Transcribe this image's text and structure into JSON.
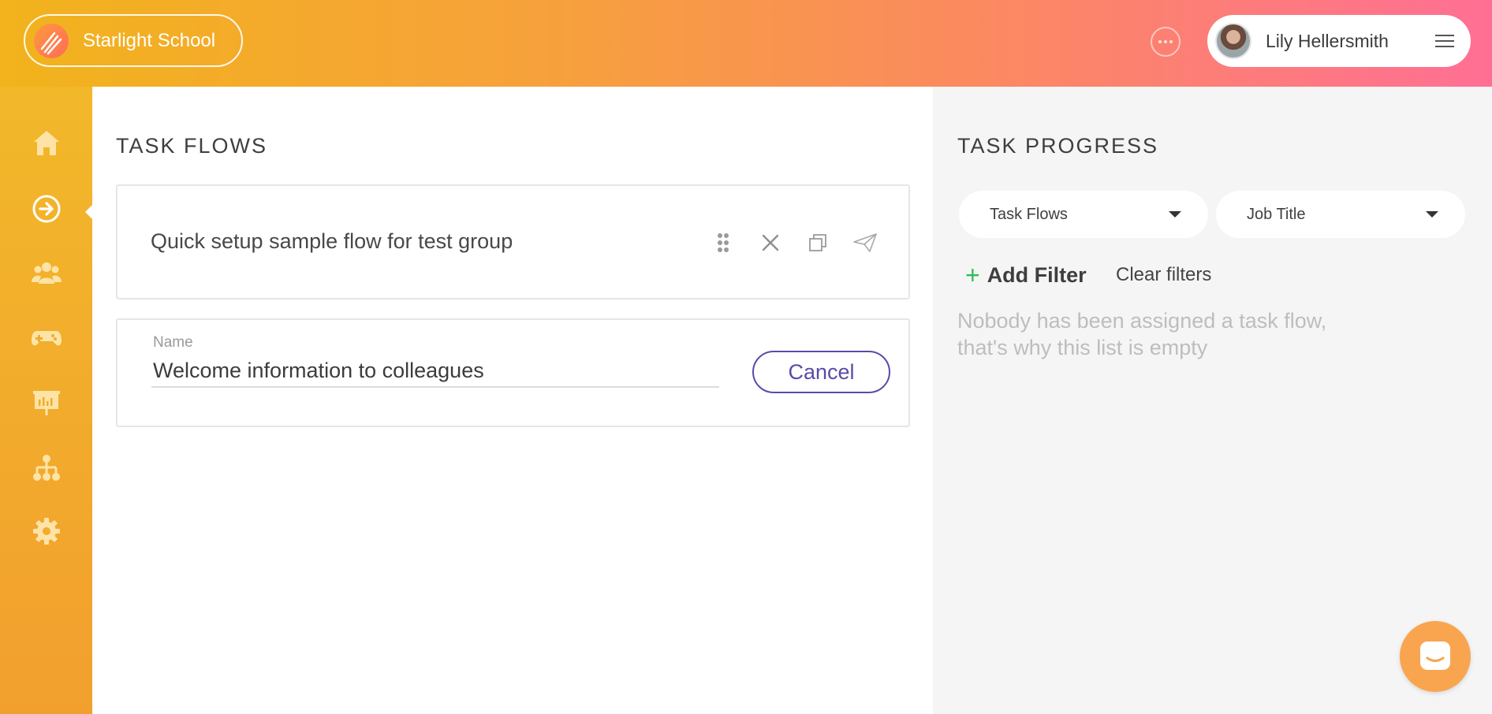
{
  "header": {
    "school_name": "Starlight School",
    "user_name": "Lily Hellersmith"
  },
  "sidebar": {
    "items": [
      {
        "name": "home",
        "icon": "home-icon",
        "active": false
      },
      {
        "name": "task-flows",
        "icon": "arrow-circle-right-icon",
        "active": true
      },
      {
        "name": "people",
        "icon": "group-icon",
        "active": false
      },
      {
        "name": "games",
        "icon": "gamepad-icon",
        "active": false
      },
      {
        "name": "presentations",
        "icon": "presentation-board-icon",
        "active": false
      },
      {
        "name": "organization",
        "icon": "org-chart-icon",
        "active": false
      },
      {
        "name": "settings",
        "icon": "gear-icon",
        "active": false
      }
    ]
  },
  "main": {
    "title": "TASK FLOWS",
    "flow_card": {
      "title": "Quick setup sample flow for test group",
      "actions": [
        "drag-handle-icon",
        "close-icon",
        "copy-icon",
        "send-icon"
      ]
    },
    "edit_card": {
      "field_label": "Name",
      "field_value": "Welcome information to colleagues",
      "cancel_label": "Cancel"
    }
  },
  "progress": {
    "title": "TASK PROGRESS",
    "filter_task_flows": "Task Flows",
    "filter_job_title": "Job Title",
    "add_filter_label": "Add Filter",
    "clear_filters_label": "Clear filters",
    "empty_line1": "Nobody has been assigned a task flow,",
    "empty_line2": "that's why this list is empty"
  },
  "colors": {
    "accent_purple": "#5b4aa8",
    "add_green": "#2bbf55",
    "sidebar_top": "#f2b82a",
    "header_end": "#ff6f94"
  }
}
